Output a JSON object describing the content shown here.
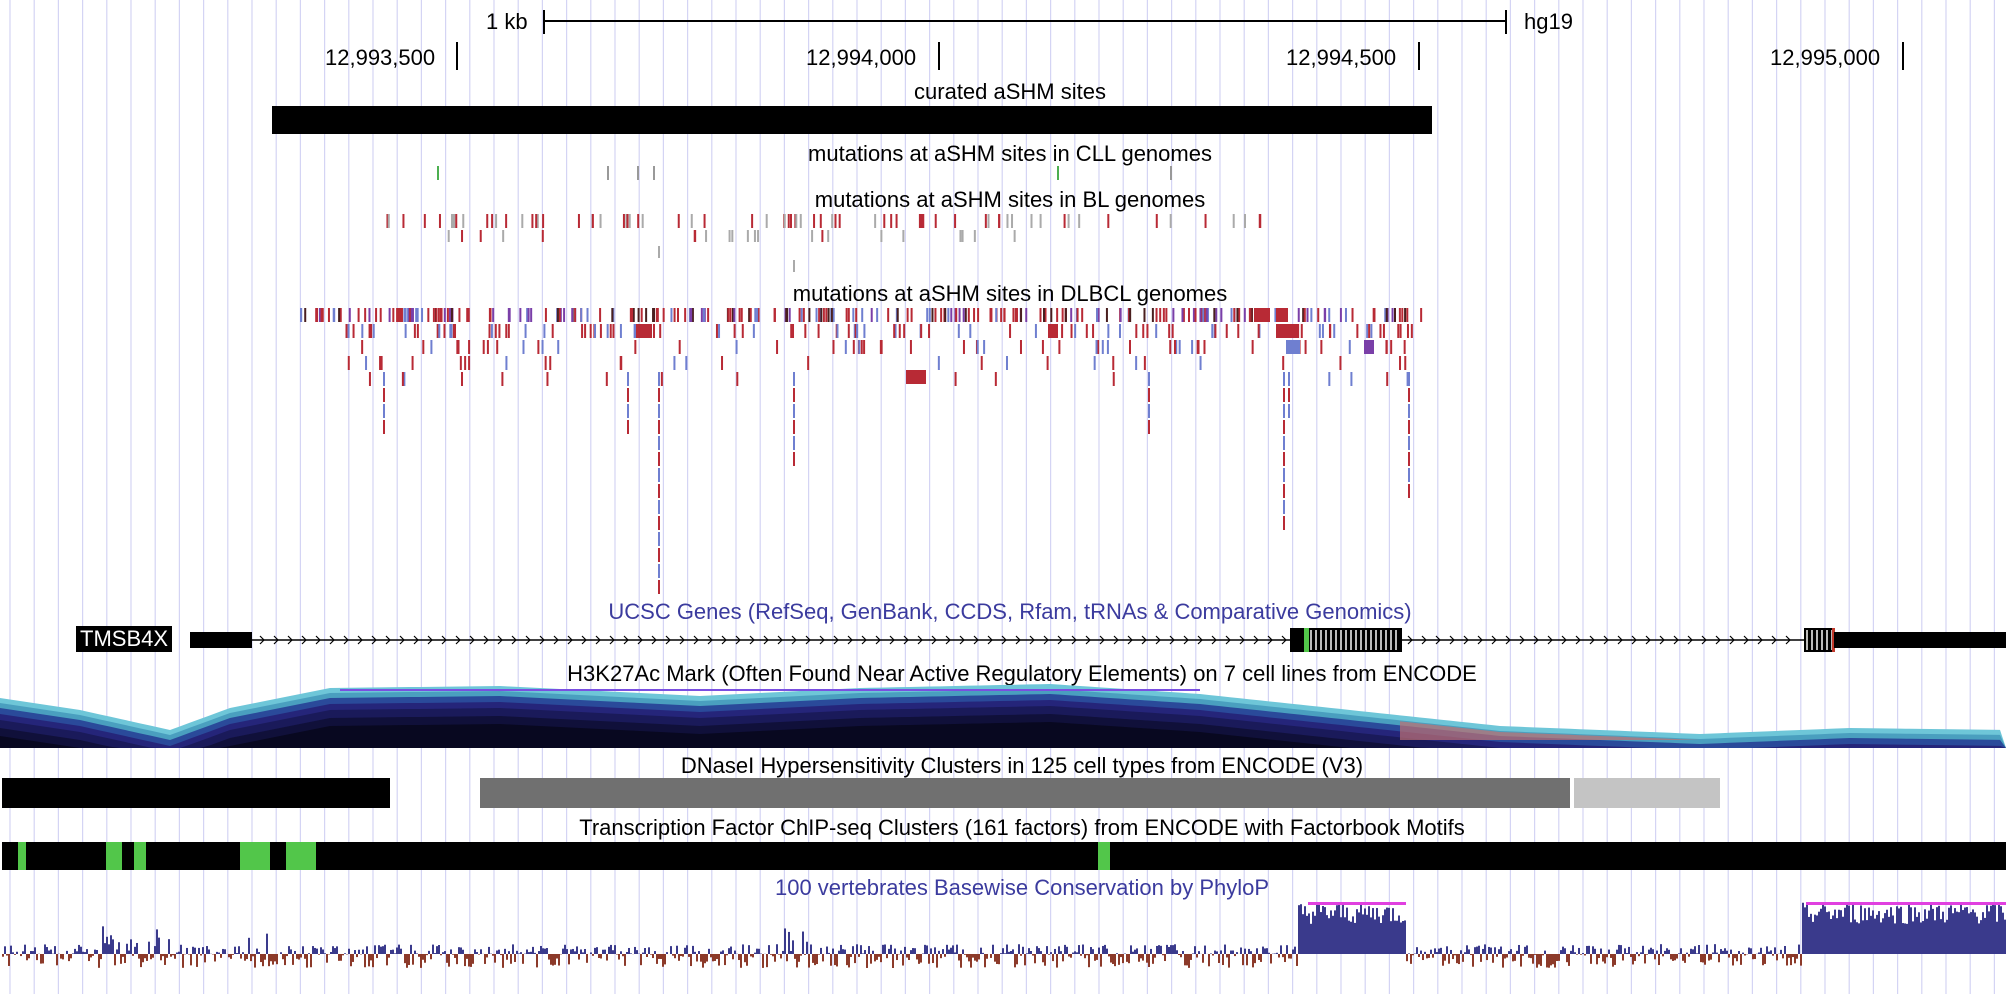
{
  "scale_bar": {
    "label": "1 kb",
    "assembly": "hg19"
  },
  "ruler": {
    "ticks": [
      "12,993,500",
      "12,994,000",
      "12,994,500",
      "12,995,000"
    ]
  },
  "tracks": {
    "curated_ashm": {
      "label": "curated aSHM sites"
    },
    "cll": {
      "label": "mutations at aSHM sites in CLL genomes"
    },
    "bl": {
      "label": "mutations at aSHM sites in BL genomes"
    },
    "dlbcl": {
      "label": "mutations at aSHM sites in DLBCL genomes"
    },
    "ucsc_genes": {
      "label": "UCSC Genes (RefSeq, GenBank, CCDS, Rfam, tRNAs & Comparative Genomics)",
      "gene_name": "TMSB4X"
    },
    "h3k27ac": {
      "label": "H3K27Ac Mark (Often Found Near Active Regulatory Elements) on 7 cell lines from ENCODE"
    },
    "dnase": {
      "label": "DNaseI Hypersensitivity Clusters in 125 cell types from ENCODE (V3)"
    },
    "tfbs": {
      "label": "Transcription Factor ChIP-seq Clusters (161 factors) from ENCODE with Factorbook Motifs"
    },
    "phylop": {
      "label": "100 vertebrates Basewise Conservation by PhyloP"
    }
  },
  "colors": {
    "grid": "#d4d4f4",
    "mutation_red": "#b82a35",
    "mutation_blue": "#6f7fd0",
    "mutation_purple": "#7a3fa8",
    "tfbs_green": "#52c64a",
    "phylop_pos": "#3a3a8c",
    "phylop_neg": "#8c3a2a",
    "dnase_dark": "#707070",
    "dnase_light": "#c4c4c4"
  }
}
